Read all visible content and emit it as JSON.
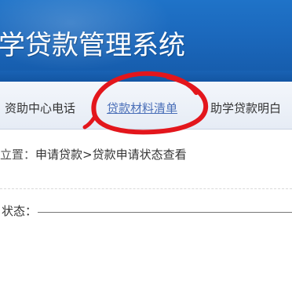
{
  "banner": {
    "title": "学贷款管理系统"
  },
  "nav": {
    "left_label": "资助中心电话",
    "link_label": "贷款材料清单",
    "right_label": "助学贷款明白"
  },
  "breadcrumb": {
    "prefix": "立置：",
    "path": "申请贷款>贷款申请状态查看"
  },
  "status": {
    "label": "状态：",
    "value": ""
  },
  "colors": {
    "banner_blue": "#1b68bc",
    "link_blue": "#4a6fb8",
    "annotation_red": "#e3161c"
  }
}
